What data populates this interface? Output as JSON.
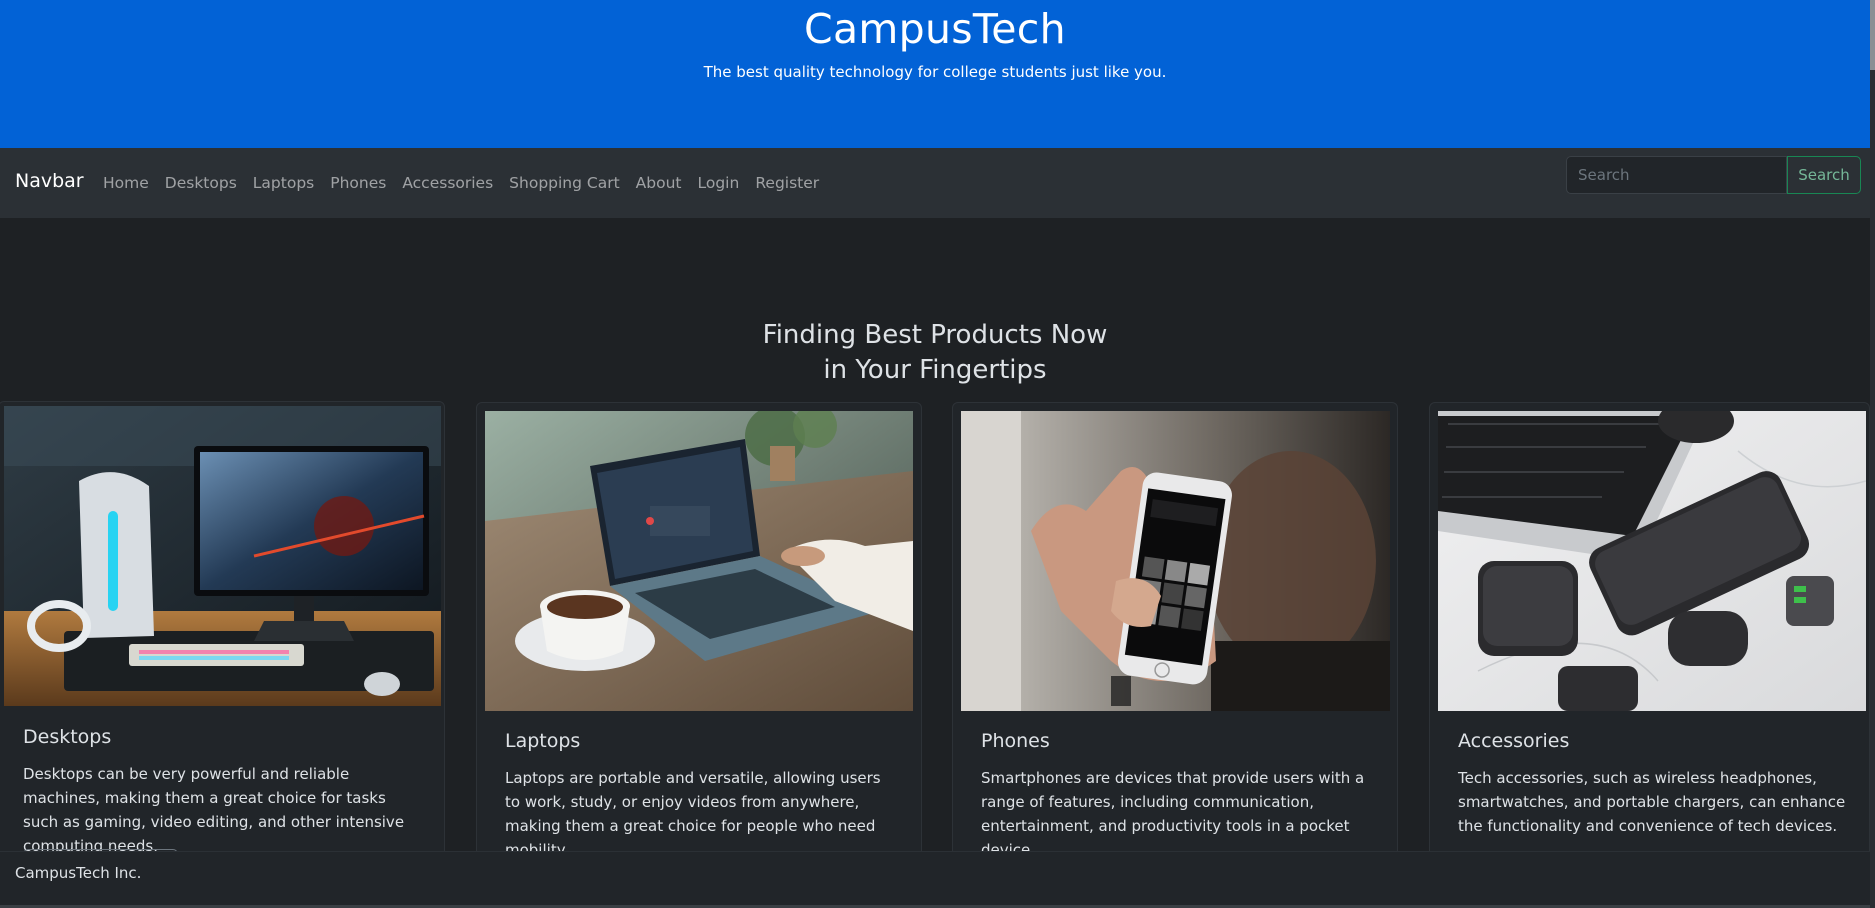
{
  "hero": {
    "title": "CampusTech",
    "subtitle": "The best quality technology for college students just like you."
  },
  "navbar": {
    "brand": "Navbar",
    "links": [
      "Home",
      "Desktops",
      "Laptops",
      "Phones",
      "Accessories",
      "Shopping Cart",
      "About",
      "Login",
      "Register"
    ],
    "search_placeholder": "Search",
    "search_button": "Search"
  },
  "section": {
    "title_line1": "Finding Best Products Now",
    "title_line2": "in Your Fingertips"
  },
  "cards": [
    {
      "title": "Desktops",
      "text": "Desktops can be very powerful and reliable machines, making them a great choice for tasks such as gaming, video editing, and other intensive computing needs."
    },
    {
      "title": "Laptops",
      "text": "Laptops are portable and versatile, allowing users to work, study, or enjoy videos from anywhere, making them a great choice for people who need mobility."
    },
    {
      "title": "Phones",
      "text": "Smartphones are devices that provide users with a range of features, including communication, entertainment, and productivity tools in a pocket device."
    },
    {
      "title": "Accessories",
      "text": "Tech accessories, such as wireless headphones, smartwatches, and portable chargers, can enhance the functionality and convenience of tech devices."
    }
  ],
  "footer": {
    "text": "CampusTech Inc."
  },
  "colors": {
    "hero_bg": "#0262d6",
    "navbar_bg": "#2b3035",
    "page_bg": "#1e2124",
    "search_accent": "#198754"
  }
}
